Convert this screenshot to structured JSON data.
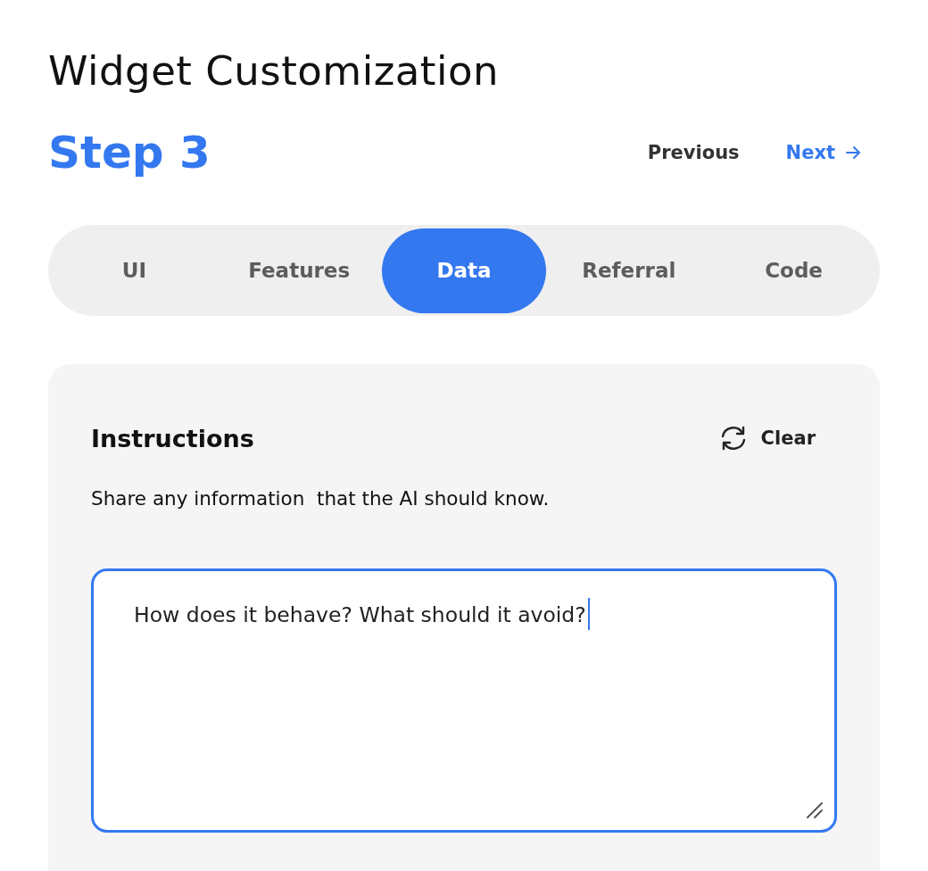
{
  "title": "Widget Customization",
  "step": "Step 3",
  "nav": [
    {
      "label": "Previous",
      "kind": "back"
    },
    {
      "label": "Next",
      "kind": "forward"
    }
  ],
  "tabs": [
    {
      "label": "UI",
      "selected": false
    },
    {
      "label": "Features",
      "selected": false
    },
    {
      "label": "Data",
      "selected": true
    },
    {
      "label": "Referral",
      "selected": false
    },
    {
      "label": "Code",
      "selected": false
    }
  ],
  "card": {
    "heading": "Instructions",
    "clear_button": {
      "label": "Clear"
    },
    "description": "Share any information  that the AI should know.",
    "field": {
      "value": "How does it behave? What should it avoid?",
      "focused": true
    }
  }
}
